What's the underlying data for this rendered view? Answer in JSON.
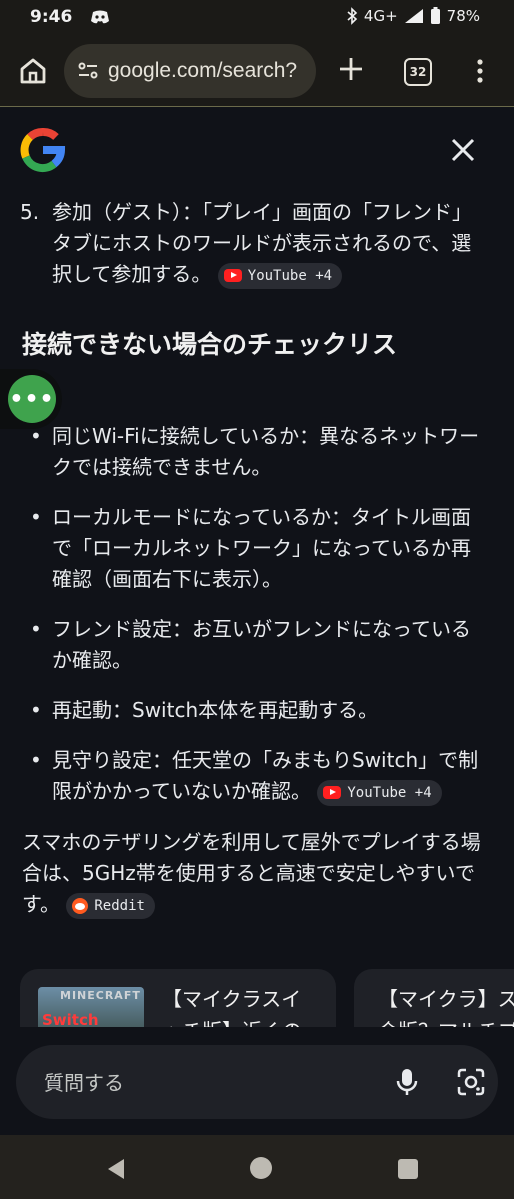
{
  "status_bar": {
    "time": "9:46",
    "network": "4G+",
    "battery": "78%"
  },
  "toolbar": {
    "url": "google.com/search?",
    "tab_count": "32"
  },
  "answer": {
    "step_number": "5.",
    "step_text": "参加（ゲスト）：「プレイ」画面の「フレンド」タブにホストのワールドが表示されるので、選択して参加する。",
    "step_chip": "YouTube +4",
    "heading": "接続できない場合のチェックリス",
    "fab_label": "•••",
    "checklist": [
      {
        "text": "同じWi-Fiに接続しているか：異なるネットワークでは接続できません。"
      },
      {
        "text": "ローカルモードになっているか：タイトル画面で「ローカルネットワーク」になっているか再確認（画面右下に表示）。"
      },
      {
        "text": "フレンド設定：お互いがフレンドになっているか確認。"
      },
      {
        "text": "再起動：Switch本体を再起動する。"
      },
      {
        "text": "見守り設定：任天堂の「みまもりSwitch」で制限がかかっていないか確認。",
        "chip": "YouTube +4"
      }
    ],
    "closing_text": "スマホのテザリングを利用して屋外でプレイする場合は、5GHz帯を使用すると高速で安定しやすいです。",
    "closing_chip": "Reddit"
  },
  "cards": [
    {
      "thumb_top": "MINECRAFT",
      "thumb_bottom": "Switch",
      "line1": "【マイクラスイ",
      "line2": "ッチ版】近くの"
    },
    {
      "line1": "【マイクラ】ス",
      "line2": "合版？マルチプ"
    }
  ],
  "ask": {
    "placeholder": "質問する"
  }
}
